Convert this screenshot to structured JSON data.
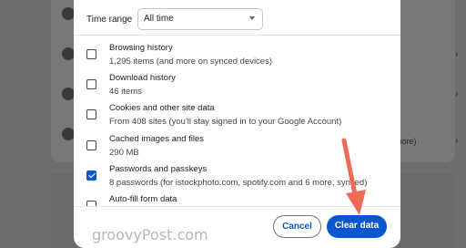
{
  "background": {
    "more_text": "more)"
  },
  "dialog": {
    "time_range_label": "Time range",
    "time_range_value": "All time",
    "items": [
      {
        "title": "Browsing history",
        "subtitle": "1,295 items (and more on synced devices)",
        "checked": false
      },
      {
        "title": "Download history",
        "subtitle": "46 items",
        "checked": false
      },
      {
        "title": "Cookies and other site data",
        "subtitle": "From 408 sites (you'll stay signed in to your Google Account)",
        "checked": false
      },
      {
        "title": "Cached images and files",
        "subtitle": "290 MB",
        "checked": false
      },
      {
        "title": "Passwords and passkeys",
        "subtitle": "8 passwords (for istockphoto.com, spotify.com and 6 more, synced)",
        "checked": true
      },
      {
        "title": "Auto-fill form data",
        "subtitle": "",
        "checked": false
      }
    ],
    "cancel_label": "Cancel",
    "clear_label": "Clear data"
  },
  "watermark": "groovyPost.com",
  "colors": {
    "accent": "#0b57d0",
    "arrow": "#f06a5a"
  }
}
